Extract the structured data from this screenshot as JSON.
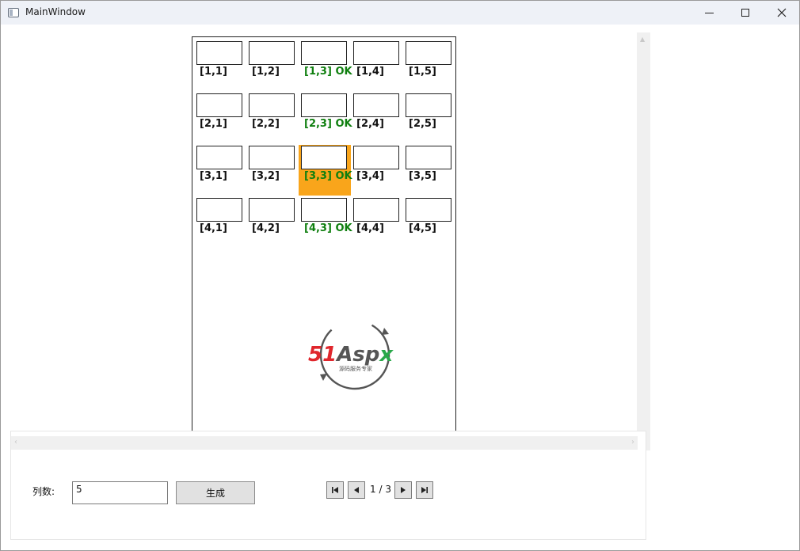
{
  "window": {
    "title": "MainWindow"
  },
  "grid": {
    "rows": [
      {
        "cells": [
          {
            "label": "[1,1]",
            "ok": false
          },
          {
            "label": "[1,2]",
            "ok": false
          },
          {
            "label": "[1,3] OK",
            "ok": true
          },
          {
            "label": "[1,4]",
            "ok": false
          },
          {
            "label": "[1,5]",
            "ok": false
          }
        ]
      },
      {
        "cells": [
          {
            "label": "[2,1]",
            "ok": false
          },
          {
            "label": "[2,2]",
            "ok": false
          },
          {
            "label": "[2,3] OK",
            "ok": true
          },
          {
            "label": "[2,4]",
            "ok": false
          },
          {
            "label": "[2,5]",
            "ok": false
          }
        ]
      },
      {
        "cells": [
          {
            "label": "[3,1]",
            "ok": false
          },
          {
            "label": "[3,2]",
            "ok": false
          },
          {
            "label": "[3,3] OK",
            "ok": true,
            "selected": true
          },
          {
            "label": "[3,4]",
            "ok": false
          },
          {
            "label": "[3,5]",
            "ok": false
          }
        ]
      },
      {
        "cells": [
          {
            "label": "[4,1]",
            "ok": false
          },
          {
            "label": "[4,2]",
            "ok": false
          },
          {
            "label": "[4,3] OK",
            "ok": true
          },
          {
            "label": "[4,4]",
            "ok": false
          },
          {
            "label": "[4,5]",
            "ok": false
          }
        ]
      }
    ]
  },
  "watermark": {
    "brand": "51Aspx",
    "tagline": "源码服务专家"
  },
  "controls": {
    "columns_label": "列数:",
    "columns_value": "5",
    "generate_label": "生成"
  },
  "pager": {
    "current": "1",
    "separator": "/",
    "total": "3"
  },
  "colors": {
    "ok_text": "#0f7f0f",
    "highlight": "#f9a51b",
    "logo_red": "#e0262c",
    "logo_green": "#2aa84a",
    "logo_gray": "#555555"
  },
  "icons": [
    "app-icon",
    "minimize-icon",
    "maximize-icon",
    "close-icon",
    "first-page-icon",
    "prev-page-icon",
    "next-page-icon",
    "last-page-icon"
  ]
}
